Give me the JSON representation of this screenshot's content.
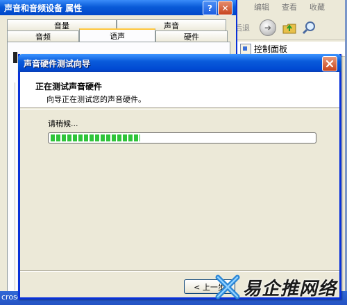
{
  "explorer": {
    "menu": [
      "编辑",
      "查看",
      "收藏"
    ],
    "back_label": "后退",
    "address": "控制面板"
  },
  "props": {
    "title": "声音和音频设备 属性",
    "tabs_top": [
      "音量",
      "声音"
    ],
    "tabs_bottom": [
      "音频",
      "语声",
      "硬件"
    ]
  },
  "wizard": {
    "title": "声音硬件测试向导",
    "header_title": "正在测试声音硬件",
    "header_subtitle": "向导正在测试您的声音硬件。",
    "wait_label": "请稍候...",
    "progress": 0.34,
    "back_button": "< 上一步"
  },
  "taskbar": {
    "text": "croso"
  },
  "watermark": {
    "text": "易企推网络"
  }
}
